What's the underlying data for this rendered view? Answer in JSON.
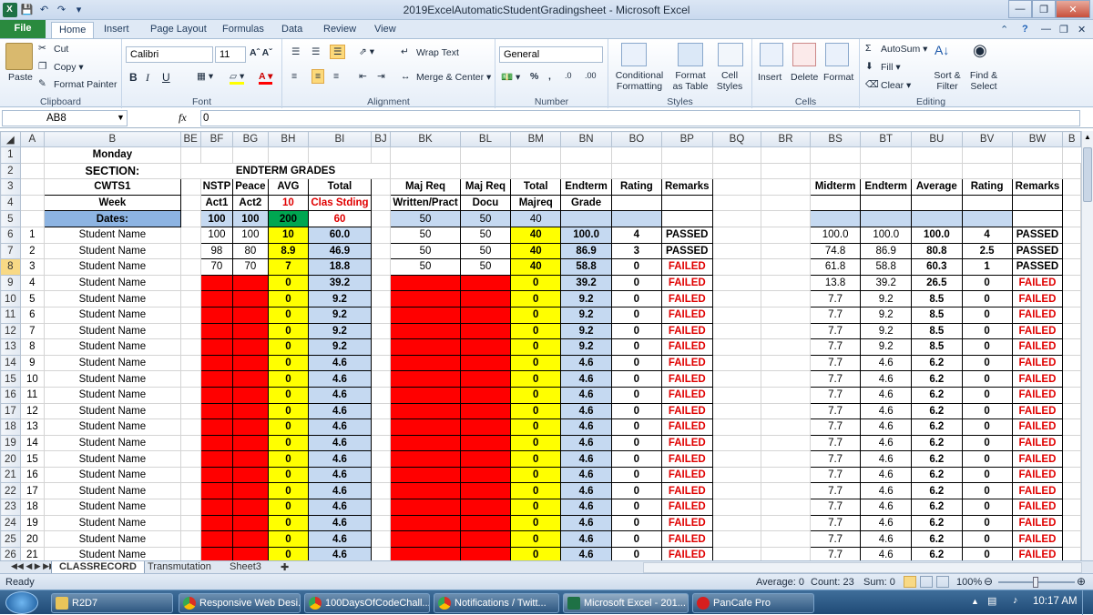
{
  "window": {
    "title": "2019ExcelAutomaticStudentGradingsheet  -  Microsoft Excel"
  },
  "ribbon_tabs": [
    "File",
    "Home",
    "Insert",
    "Page Layout",
    "Formulas",
    "Data",
    "Review",
    "View"
  ],
  "clipboard": {
    "paste": "Paste",
    "cut": "Cut",
    "copy": "Copy",
    "format_painter": "Format Painter",
    "label": "Clipboard"
  },
  "font": {
    "name": "Calibri",
    "size": "11",
    "label": "Font"
  },
  "alignment": {
    "wrap": "Wrap Text",
    "merge": "Merge & Center",
    "label": "Alignment"
  },
  "number": {
    "format": "General",
    "label": "Number"
  },
  "styles": {
    "cond": "Conditional Formatting",
    "table": "Format as Table",
    "cell": "Cell Styles",
    "label": "Styles"
  },
  "cells": {
    "insert": "Insert",
    "delete": "Delete",
    "format": "Format",
    "label": "Cells"
  },
  "editing": {
    "autosum": "AutoSum",
    "fill": "Fill",
    "clear": "Clear",
    "sort": "Sort & Filter",
    "find": "Find & Select",
    "label": "Editing"
  },
  "formula_bar": {
    "name_box": "AB8",
    "fx": "fx",
    "value": "0"
  },
  "columns": [
    "A",
    "B",
    "BE",
    "BF",
    "BG",
    "BH",
    "BI",
    "BJ",
    "BK",
    "BL",
    "BM",
    "BN",
    "BO",
    "BP",
    "BQ",
    "BR",
    "BS",
    "BT",
    "BU",
    "BV",
    "BW",
    "B"
  ],
  "header_rows": {
    "r1": {
      "B": "Monday"
    },
    "r2": {
      "B": "SECTION:",
      "BE": "ENDTERM GRADES"
    },
    "r3": {
      "B": "CWTS1",
      "BF": "NSTP",
      "BG": "Peace",
      "BH": "AVG",
      "BI": "Total",
      "BK": "Maj Req",
      "BL": "Maj Req",
      "BM": "Total",
      "BN": "Endterm",
      "BO": "Rating",
      "BP": "Remarks",
      "BS": "Midterm",
      "BT": "Endterm",
      "BU": "Average",
      "BV": "Rating",
      "BW": "Remarks"
    },
    "r4": {
      "B": "Week",
      "BF": "Act1",
      "BG": "Act2",
      "BH": "10",
      "BI": "Clas Stding",
      "BK": "Written/Pract",
      "BL": "Docu",
      "BM": "Majreq",
      "BN": "Grade"
    },
    "r5": {
      "B": "Dates:",
      "BF": "100",
      "BG": "100",
      "BH": "200",
      "BI": "60",
      "BK": "50",
      "BL": "50",
      "BM": "40"
    }
  },
  "students": [
    {
      "row": "6",
      "a": "1",
      "name": "Student Name",
      "bf": "100",
      "bg": "100",
      "bh": "10",
      "bi": "60.0",
      "bk": "50",
      "bl": "50",
      "bm": "40",
      "bn": "100.0",
      "bo": "4",
      "bp": "PASSED",
      "bs": "100.0",
      "bt": "100.0",
      "bu": "100.0",
      "bv": "4",
      "bw": "PASSED"
    },
    {
      "row": "7",
      "a": "2",
      "name": "Student Name",
      "bf": "98",
      "bg": "80",
      "bh": "8.9",
      "bi": "46.9",
      "bk": "50",
      "bl": "50",
      "bm": "40",
      "bn": "86.9",
      "bo": "3",
      "bp": "PASSED",
      "bs": "74.8",
      "bt": "86.9",
      "bu": "80.8",
      "bv": "2.5",
      "bw": "PASSED"
    },
    {
      "row": "8",
      "a": "3",
      "name": "Student Name",
      "bf": "70",
      "bg": "70",
      "bh": "7",
      "bi": "18.8",
      "bk": "50",
      "bl": "50",
      "bm": "40",
      "bn": "58.8",
      "bo": "0",
      "bp": "FAILED",
      "bs": "61.8",
      "bt": "58.8",
      "bu": "60.3",
      "bv": "1",
      "bw": "PASSED"
    },
    {
      "row": "9",
      "a": "4",
      "name": "Student Name",
      "bf": "",
      "bg": "",
      "bh": "0",
      "bi": "39.2",
      "bk": "",
      "bl": "",
      "bm": "0",
      "bn": "39.2",
      "bo": "0",
      "bp": "FAILED",
      "bs": "13.8",
      "bt": "39.2",
      "bu": "26.5",
      "bv": "0",
      "bw": "FAILED"
    },
    {
      "row": "10",
      "a": "5",
      "name": "Student Name",
      "bf": "",
      "bg": "",
      "bh": "0",
      "bi": "9.2",
      "bk": "",
      "bl": "",
      "bm": "0",
      "bn": "9.2",
      "bo": "0",
      "bp": "FAILED",
      "bs": "7.7",
      "bt": "9.2",
      "bu": "8.5",
      "bv": "0",
      "bw": "FAILED"
    },
    {
      "row": "11",
      "a": "6",
      "name": "Student Name",
      "bf": "",
      "bg": "",
      "bh": "0",
      "bi": "9.2",
      "bk": "",
      "bl": "",
      "bm": "0",
      "bn": "9.2",
      "bo": "0",
      "bp": "FAILED",
      "bs": "7.7",
      "bt": "9.2",
      "bu": "8.5",
      "bv": "0",
      "bw": "FAILED"
    },
    {
      "row": "12",
      "a": "7",
      "name": "Student Name",
      "bf": "",
      "bg": "",
      "bh": "0",
      "bi": "9.2",
      "bk": "",
      "bl": "",
      "bm": "0",
      "bn": "9.2",
      "bo": "0",
      "bp": "FAILED",
      "bs": "7.7",
      "bt": "9.2",
      "bu": "8.5",
      "bv": "0",
      "bw": "FAILED"
    },
    {
      "row": "13",
      "a": "8",
      "name": "Student Name",
      "bf": "",
      "bg": "",
      "bh": "0",
      "bi": "9.2",
      "bk": "",
      "bl": "",
      "bm": "0",
      "bn": "9.2",
      "bo": "0",
      "bp": "FAILED",
      "bs": "7.7",
      "bt": "9.2",
      "bu": "8.5",
      "bv": "0",
      "bw": "FAILED"
    },
    {
      "row": "14",
      "a": "9",
      "name": "Student Name",
      "bf": "",
      "bg": "",
      "bh": "0",
      "bi": "4.6",
      "bk": "",
      "bl": "",
      "bm": "0",
      "bn": "4.6",
      "bo": "0",
      "bp": "FAILED",
      "bs": "7.7",
      "bt": "4.6",
      "bu": "6.2",
      "bv": "0",
      "bw": "FAILED"
    },
    {
      "row": "15",
      "a": "10",
      "name": "Student Name",
      "bf": "",
      "bg": "",
      "bh": "0",
      "bi": "4.6",
      "bk": "",
      "bl": "",
      "bm": "0",
      "bn": "4.6",
      "bo": "0",
      "bp": "FAILED",
      "bs": "7.7",
      "bt": "4.6",
      "bu": "6.2",
      "bv": "0",
      "bw": "FAILED"
    },
    {
      "row": "16",
      "a": "11",
      "name": "Student Name",
      "bf": "",
      "bg": "",
      "bh": "0",
      "bi": "4.6",
      "bk": "",
      "bl": "",
      "bm": "0",
      "bn": "4.6",
      "bo": "0",
      "bp": "FAILED",
      "bs": "7.7",
      "bt": "4.6",
      "bu": "6.2",
      "bv": "0",
      "bw": "FAILED"
    },
    {
      "row": "17",
      "a": "12",
      "name": "Student Name",
      "bf": "",
      "bg": "",
      "bh": "0",
      "bi": "4.6",
      "bk": "",
      "bl": "",
      "bm": "0",
      "bn": "4.6",
      "bo": "0",
      "bp": "FAILED",
      "bs": "7.7",
      "bt": "4.6",
      "bu": "6.2",
      "bv": "0",
      "bw": "FAILED"
    },
    {
      "row": "18",
      "a": "13",
      "name": "Student Name",
      "bf": "",
      "bg": "",
      "bh": "0",
      "bi": "4.6",
      "bk": "",
      "bl": "",
      "bm": "0",
      "bn": "4.6",
      "bo": "0",
      "bp": "FAILED",
      "bs": "7.7",
      "bt": "4.6",
      "bu": "6.2",
      "bv": "0",
      "bw": "FAILED"
    },
    {
      "row": "19",
      "a": "14",
      "name": "Student Name",
      "bf": "",
      "bg": "",
      "bh": "0",
      "bi": "4.6",
      "bk": "",
      "bl": "",
      "bm": "0",
      "bn": "4.6",
      "bo": "0",
      "bp": "FAILED",
      "bs": "7.7",
      "bt": "4.6",
      "bu": "6.2",
      "bv": "0",
      "bw": "FAILED"
    },
    {
      "row": "20",
      "a": "15",
      "name": "Student Name",
      "bf": "",
      "bg": "",
      "bh": "0",
      "bi": "4.6",
      "bk": "",
      "bl": "",
      "bm": "0",
      "bn": "4.6",
      "bo": "0",
      "bp": "FAILED",
      "bs": "7.7",
      "bt": "4.6",
      "bu": "6.2",
      "bv": "0",
      "bw": "FAILED"
    },
    {
      "row": "21",
      "a": "16",
      "name": "Student Name",
      "bf": "",
      "bg": "",
      "bh": "0",
      "bi": "4.6",
      "bk": "",
      "bl": "",
      "bm": "0",
      "bn": "4.6",
      "bo": "0",
      "bp": "FAILED",
      "bs": "7.7",
      "bt": "4.6",
      "bu": "6.2",
      "bv": "0",
      "bw": "FAILED"
    },
    {
      "row": "22",
      "a": "17",
      "name": "Student Name",
      "bf": "",
      "bg": "",
      "bh": "0",
      "bi": "4.6",
      "bk": "",
      "bl": "",
      "bm": "0",
      "bn": "4.6",
      "bo": "0",
      "bp": "FAILED",
      "bs": "7.7",
      "bt": "4.6",
      "bu": "6.2",
      "bv": "0",
      "bw": "FAILED"
    },
    {
      "row": "23",
      "a": "18",
      "name": "Student Name",
      "bf": "",
      "bg": "",
      "bh": "0",
      "bi": "4.6",
      "bk": "",
      "bl": "",
      "bm": "0",
      "bn": "4.6",
      "bo": "0",
      "bp": "FAILED",
      "bs": "7.7",
      "bt": "4.6",
      "bu": "6.2",
      "bv": "0",
      "bw": "FAILED"
    },
    {
      "row": "24",
      "a": "19",
      "name": "Student Name",
      "bf": "",
      "bg": "",
      "bh": "0",
      "bi": "4.6",
      "bk": "",
      "bl": "",
      "bm": "0",
      "bn": "4.6",
      "bo": "0",
      "bp": "FAILED",
      "bs": "7.7",
      "bt": "4.6",
      "bu": "6.2",
      "bv": "0",
      "bw": "FAILED"
    },
    {
      "row": "25",
      "a": "20",
      "name": "Student Name",
      "bf": "",
      "bg": "",
      "bh": "0",
      "bi": "4.6",
      "bk": "",
      "bl": "",
      "bm": "0",
      "bn": "4.6",
      "bo": "0",
      "bp": "FAILED",
      "bs": "7.7",
      "bt": "4.6",
      "bu": "6.2",
      "bv": "0",
      "bw": "FAILED"
    },
    {
      "row": "26",
      "a": "21",
      "name": "Student Name",
      "bf": "",
      "bg": "",
      "bh": "0",
      "bi": "4.6",
      "bk": "",
      "bl": "",
      "bm": "0",
      "bn": "4.6",
      "bo": "0",
      "bp": "FAILED",
      "bs": "7.7",
      "bt": "4.6",
      "bu": "6.2",
      "bv": "0",
      "bw": "FAILED"
    }
  ],
  "sheet_tabs": [
    "CLASSRECORD",
    "Transmutation",
    "Sheet3"
  ],
  "status": {
    "ready": "Ready",
    "average": "Average: 0",
    "count": "Count: 23",
    "sum": "Sum: 0",
    "zoom": "100%"
  },
  "taskbar": {
    "items": [
      "R2D7",
      "Responsive Web Desi...",
      "100DaysOfCodeChall...",
      "Notifications / Twitt...",
      "Microsoft Excel - 201...",
      "PanCafe Pro"
    ],
    "time": "10:17 AM"
  }
}
